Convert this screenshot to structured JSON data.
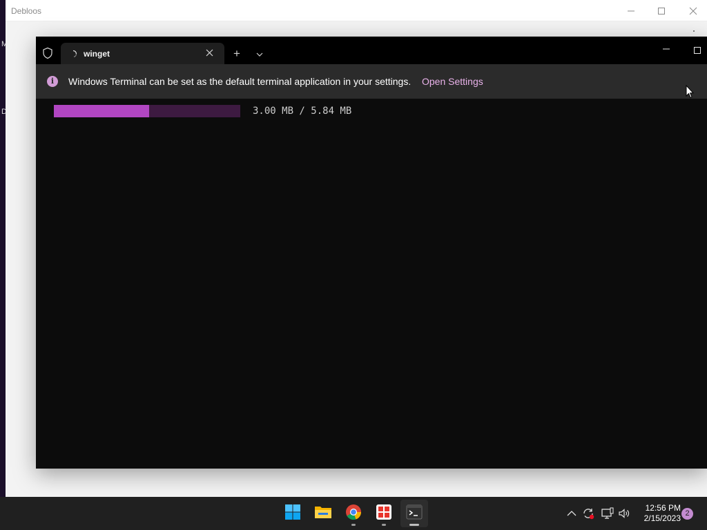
{
  "background_window": {
    "title": "Debloos",
    "left_fragments": [
      "M",
      "D"
    ]
  },
  "terminal": {
    "tab": {
      "title": "winget",
      "close_icon": "close-icon",
      "loading_icon": "spinner-icon"
    },
    "new_tab_label": "+",
    "infobar": {
      "icon": "info-icon",
      "message": "Windows Terminal can be set as the default terminal application in your settings.",
      "link_label": "Open Settings"
    },
    "progress": {
      "fraction": 0.51,
      "text": "3.00 MB / 5.84 MB",
      "fill_color": "#b146c2",
      "track_color": "#3d1a41"
    }
  },
  "taskbar": {
    "apps": [
      {
        "name": "start-button",
        "icon": "windows-logo-icon"
      },
      {
        "name": "file-explorer",
        "icon": "folder-icon"
      },
      {
        "name": "chrome",
        "icon": "chrome-icon"
      },
      {
        "name": "office",
        "icon": "office-icon"
      },
      {
        "name": "windows-terminal",
        "icon": "terminal-icon",
        "active": true
      }
    ],
    "tray": {
      "time": "12:56 PM",
      "date": "2/15/2023",
      "notification_count": "2"
    }
  },
  "colors": {
    "accent": "#b146c2",
    "link": "#e9b2ea",
    "terminal_bg": "#0c0c0c",
    "taskbar_bg": "#202020"
  }
}
